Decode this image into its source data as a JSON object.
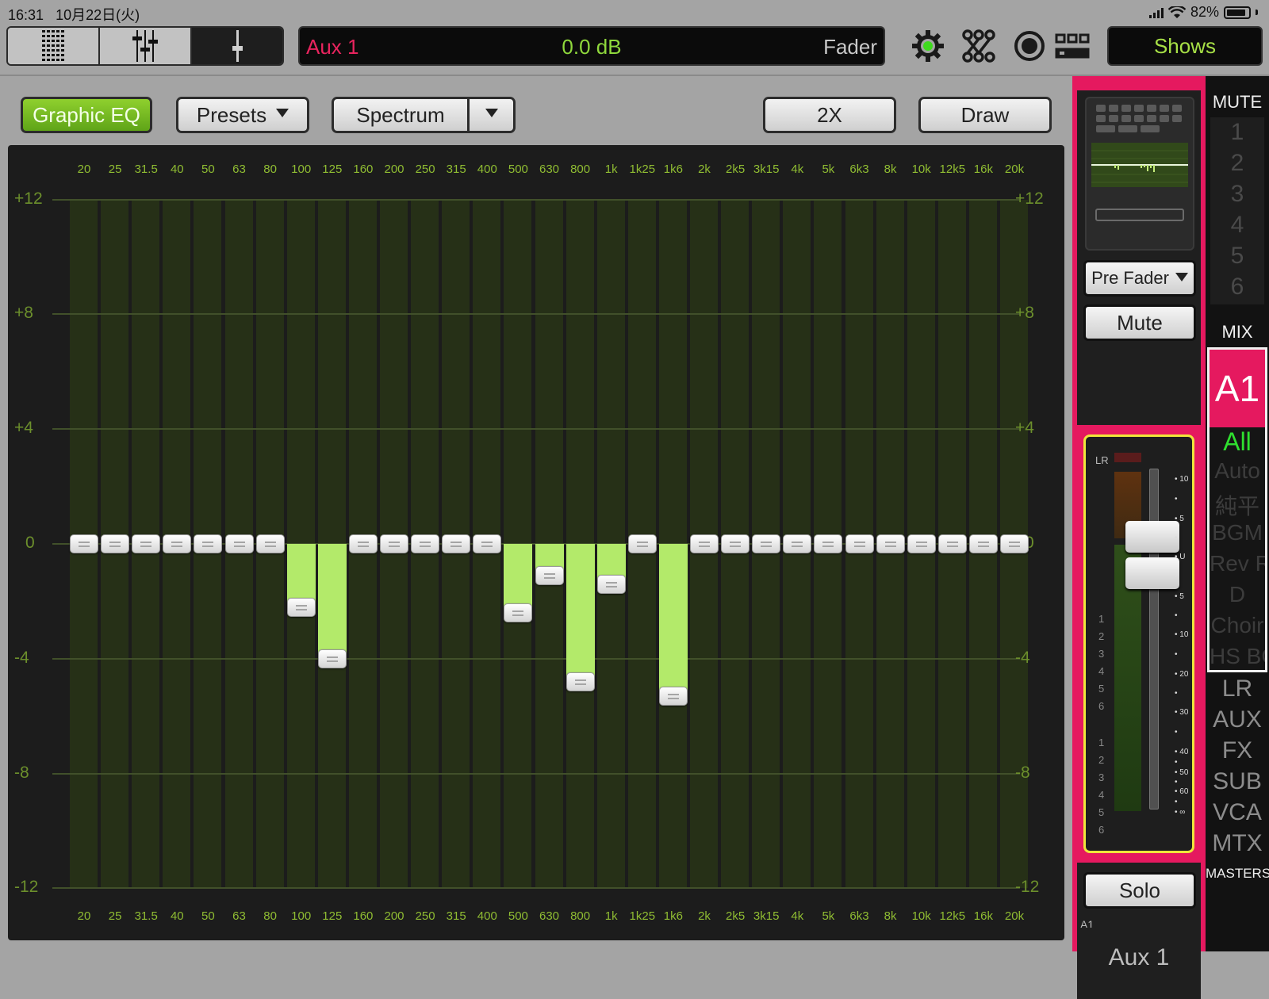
{
  "status": {
    "time": "16:31",
    "date": "10月22日(火)",
    "battery": "82%"
  },
  "topbar": {
    "channel_name": "Aux 1",
    "value": "0.0 dB",
    "control": "Fader",
    "shows_label": "Shows",
    "colors": {
      "channel": "#e8245e",
      "value": "#8fd83c",
      "accent_green": "#a7e046"
    }
  },
  "eq": {
    "mode_label": "Graphic EQ",
    "presets_label": "Presets",
    "spectrum_label": "Spectrum",
    "zoom_label": "2X",
    "draw_label": "Draw",
    "db_labels": [
      "+12",
      "+8",
      "+4",
      "0",
      "-4",
      "-8",
      "-12"
    ],
    "db_values": [
      12,
      8,
      4,
      0,
      -4,
      -8,
      -12
    ],
    "bands": [
      "20",
      "25",
      "31.5",
      "40",
      "50",
      "63",
      "80",
      "100",
      "125",
      "160",
      "200",
      "250",
      "315",
      "400",
      "500",
      "630",
      "800",
      "1k",
      "1k25",
      "1k6",
      "2k",
      "2k5",
      "3k15",
      "4k",
      "5k",
      "6k3",
      "8k",
      "10k",
      "12k5",
      "16k",
      "20k"
    ],
    "gains": [
      0,
      0,
      0,
      0,
      0,
      0,
      0,
      -2.2,
      -4,
      0,
      0,
      0,
      0,
      0,
      -2.4,
      -1.1,
      -4.8,
      -1.4,
      0,
      -5.3,
      0,
      0,
      0,
      0,
      0,
      0,
      0,
      0,
      0,
      0,
      0
    ]
  },
  "strip": {
    "send_label": "Pre Fader",
    "mute_label": "Mute",
    "solo_label": "Solo",
    "meter_label": "LR",
    "id_label": "A1",
    "name": "Aux 1",
    "scale": [
      "10",
      "5",
      "U",
      "5",
      "10",
      "20",
      "30",
      "40",
      "50",
      "60",
      "∞"
    ],
    "meter_numbers_a": [
      "1",
      "2",
      "3",
      "4",
      "5",
      "6"
    ],
    "meter_numbers_b": [
      "1",
      "2",
      "3",
      "4",
      "5",
      "6"
    ],
    "fader_level": "0.0 dB"
  },
  "nav": {
    "mute_label": "MUTE",
    "mute_groups": [
      "1",
      "2",
      "3",
      "4",
      "5",
      "6"
    ],
    "mix_label": "MIX",
    "mix_selected": "A1",
    "mix_items": [
      "All",
      "Auto",
      "純平",
      "BGM",
      "Rev Rtn",
      "D",
      "Choir",
      "HS BG"
    ],
    "groups": [
      "LR",
      "AUX",
      "FX",
      "SUB",
      "VCA",
      "MTX"
    ],
    "masters_label": "MASTERS"
  }
}
